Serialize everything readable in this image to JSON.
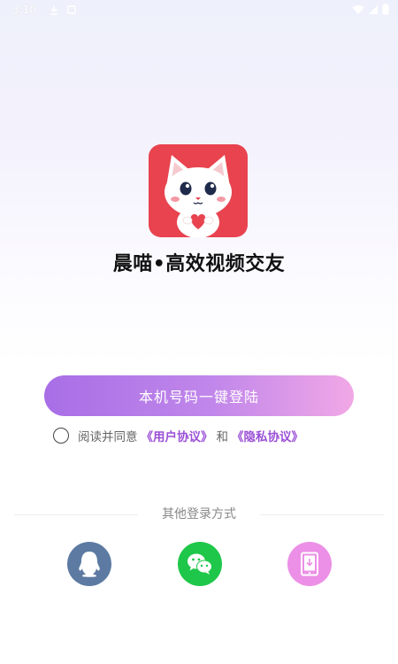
{
  "status_bar": {
    "time": "3:10"
  },
  "app": {
    "title": "晨喵•高效视频交友"
  },
  "login": {
    "button_label": "本机号码一键登陆"
  },
  "agreement": {
    "prefix": "阅读并同意",
    "user_agreement": "《用户协议》",
    "conjunction": "和",
    "privacy_agreement": "《隐私协议》"
  },
  "other_login": {
    "title": "其他登录方式",
    "methods": [
      {
        "name": "qq",
        "icon": "qq-penguin-icon",
        "color": "#5c7aa2"
      },
      {
        "name": "wechat",
        "icon": "wechat-icon",
        "color": "#1ec74a"
      },
      {
        "name": "phone",
        "icon": "phone-login-icon",
        "color": "#ec8fe6"
      }
    ]
  },
  "colors": {
    "accent": "#b57ae8",
    "link": "#9a4fd6",
    "app_icon_bg": "#e8434f"
  }
}
